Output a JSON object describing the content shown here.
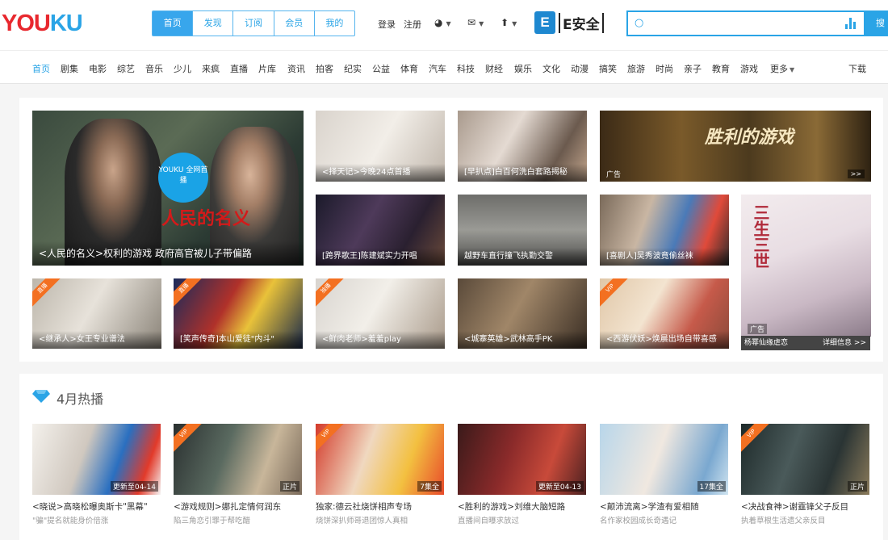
{
  "header": {
    "logo": "YOUKU",
    "logo_red": "YOU",
    "logo_blue": "KU",
    "tabs": [
      "首页",
      "发现",
      "订阅",
      "会员",
      "我的"
    ],
    "login": "登录",
    "register": "注册",
    "ad_letter": "E",
    "ad_text": "E安全",
    "search_placeholder": "",
    "search_button": "搜"
  },
  "nav": [
    "首页",
    "剧集",
    "电影",
    "综艺",
    "音乐",
    "少儿",
    "来疯",
    "直播",
    "片库",
    "资讯",
    "拍客",
    "纪实",
    "公益",
    "体育",
    "汽车",
    "科技",
    "财经",
    "娱乐",
    "文化",
    "动漫",
    "搞笑",
    "旅游",
    "时尚",
    "亲子",
    "教育",
    "游戏",
    "更多",
    "下载"
  ],
  "focus": {
    "big": {
      "caption": "<人民的名义>权利的游戏 政府高官被儿子带偏路",
      "badge": "YOUKU 全网首播",
      "slogan": "人民的名义"
    },
    "tiles": [
      "<择天记>今晚24点首播",
      "[早扒点]白百何洗白套路揭秘",
      "广告",
      "[跨界歌王]陈建斌实力开唱",
      "越野车直行撞飞执勤交警",
      "[喜剧人]吴秀波竟偷丝袜",
      "<继承人>女王专业谱法",
      "[笑声传奇]本山爱徒\"内斗\"",
      "<鲜肉老师>羞羞play",
      "<城寨英雄>武林高手PK",
      "<西游伏妖>焕晨出场自带喜感"
    ],
    "corner_labels": [
      "直播",
      "直播",
      "独播",
      "VIP"
    ],
    "side_ad": {
      "tag": "广告",
      "title": "杨幂仙缘虐恋",
      "info": "详细信息 >>",
      "more": ">>"
    },
    "poster_text": "胜利的游戏"
  },
  "hot": {
    "title": "4月热播",
    "items": [
      {
        "title": "<晓说>高晓松曝奥斯卡\"黑幕\"",
        "sub": "\"骗\"提名就能身价倍涨",
        "label": "更新至04-14"
      },
      {
        "title": "<游戏规则>娜扎定情何润东",
        "sub": "陷三角恋引罪于帮吃醋",
        "label": "正片"
      },
      {
        "title": "独家:德云社烧饼相声专场",
        "sub": "烧饼深扒师哥退团惊人真相",
        "label": "7集全"
      },
      {
        "title": "<胜利的游戏>刘维大脑短路",
        "sub": "直播间自曝求放过",
        "label": "更新至04-13"
      },
      {
        "title": "<颠沛流离>学渣有爱相随",
        "sub": "名作家校园成长奇遇记",
        "label": "17集全"
      },
      {
        "title": "<决战食神>谢霆锋父子反目",
        "sub": "执着草根生活遗父亲反目",
        "label": "正片"
      }
    ],
    "vip_label": "VIP"
  }
}
